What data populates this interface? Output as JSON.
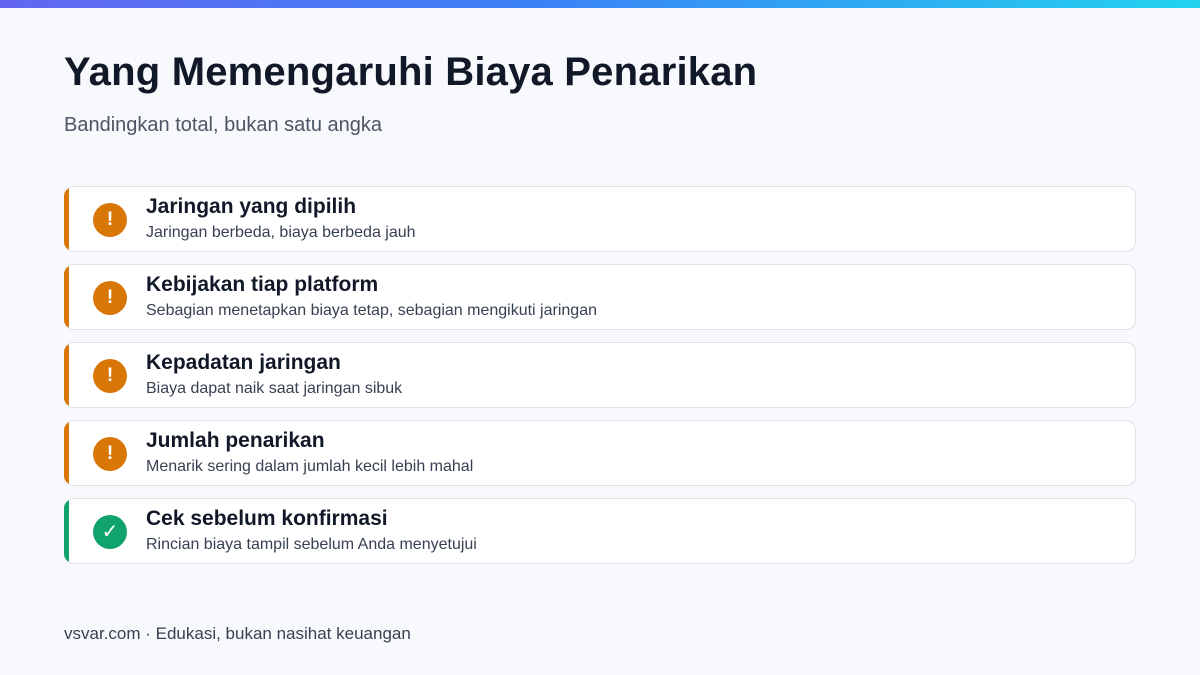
{
  "header": {
    "title": "Yang Memengaruhi Biaya Penarikan",
    "subtitle": "Bandingkan total, bukan satu angka"
  },
  "colors": {
    "warning": "#d97706",
    "success": "#10a36b",
    "title_text": "#111827",
    "gradient": [
      "#6366f1",
      "#3b82f6",
      "#22d3ee"
    ]
  },
  "cards": [
    {
      "icon": "exclamation-icon",
      "glyph": "!",
      "title": "Jaringan yang dipilih",
      "description": "Jaringan berbeda, biaya berbeda jauh"
    },
    {
      "icon": "exclamation-icon",
      "glyph": "!",
      "title": "Kebijakan tiap platform",
      "description": "Sebagian menetapkan biaya tetap, sebagian mengikuti jaringan"
    },
    {
      "icon": "exclamation-icon",
      "glyph": "!",
      "title": "Kepadatan jaringan",
      "description": "Biaya dapat naik saat jaringan sibuk"
    },
    {
      "icon": "exclamation-icon",
      "glyph": "!",
      "title": "Jumlah penarikan",
      "description": "Menarik sering dalam jumlah kecil lebih mahal"
    },
    {
      "icon": "checkmark-icon",
      "glyph": "✓",
      "title": "Cek sebelum konfirmasi",
      "description": "Rincian biaya tampil sebelum Anda menyetujui"
    }
  ],
  "footer": {
    "text": "vsvar.com · Edukasi, bukan nasihat keuangan"
  }
}
